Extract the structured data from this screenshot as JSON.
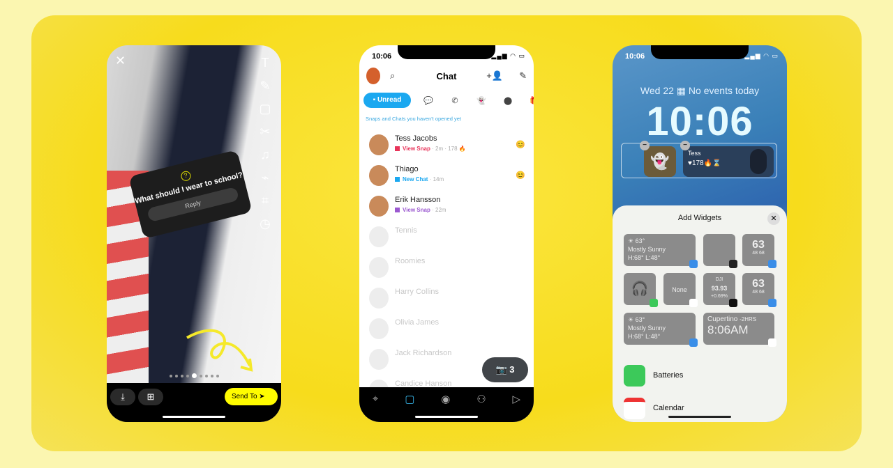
{
  "snap_editor": {
    "close_icon": "x-icon",
    "tools": [
      "text-icon",
      "pencil-icon",
      "sticker-icon",
      "scissors-icon",
      "music-icon",
      "paperclip-icon",
      "crop-icon",
      "timer-icon"
    ],
    "sticker": {
      "question": "What should I wear to school?",
      "reply": "Reply"
    },
    "send_label": "Send To",
    "page_dots": {
      "count": 9,
      "active": 4
    }
  },
  "chat": {
    "time": "10:06",
    "title": "Chat",
    "filters": [
      {
        "label": "Unread",
        "icon": "unread-icon"
      },
      {
        "icon": "chats-icon"
      },
      {
        "icon": "phone-icon"
      },
      {
        "icon": "ghost-icon"
      },
      {
        "icon": "location-icon"
      },
      {
        "icon": "gift-icon"
      }
    ],
    "hint": "Snaps and Chats you haven't opened yet",
    "rows": [
      {
        "name": "Tess Jacobs",
        "status": "View Snap",
        "meta": "· 2m · 178 🔥",
        "color": "#e8345a",
        "emoji": "😊"
      },
      {
        "name": "Thiago",
        "status": "New Chat",
        "meta": "· 14m",
        "color": "#1ba8f0",
        "emoji": "😊"
      },
      {
        "name": "Erik Hansson",
        "status": "View Snap",
        "meta": "· 22m",
        "color": "#9b59d0",
        "emoji": ""
      },
      {
        "name": "Tennis",
        "faded": true
      },
      {
        "name": "Roomies",
        "faded": true
      },
      {
        "name": "Harry Collins",
        "faded": true
      },
      {
        "name": "Olivia James",
        "faded": true
      },
      {
        "name": "Jack Richardson",
        "faded": true
      },
      {
        "name": "Candice Hanson",
        "faded": true
      }
    ],
    "camera_badge_count": "3",
    "nav": [
      "map-icon",
      "chat-icon",
      "camera-icon",
      "friends-icon",
      "stories-icon"
    ],
    "nav_active": 1
  },
  "lockscreen": {
    "time": "10:06",
    "date": "Wed 22",
    "events": "No events today",
    "clock": "10:06",
    "widget_friend": {
      "name": "Tess",
      "stats": "♥178🔥⌛"
    },
    "sheet_title": "Add Widgets",
    "widgets": {
      "weather1": {
        "temp": "☀ 63°",
        "cond": "Mostly Sunny",
        "hl": "H:68° L:48°"
      },
      "gauge": {
        "value": "63",
        "range": "48  68"
      },
      "stocks": {
        "sym": "DJI",
        "value": "93.93",
        "change": "+0.69%"
      },
      "calendar": "None",
      "weather2": {
        "temp": "☀ 63°",
        "cond": "Mostly Sunny",
        "hl": "H:68° L:48°"
      },
      "clock": {
        "city": "Cupertino",
        "offset": "-2HRS",
        "time": "8:06AM"
      }
    },
    "list": [
      {
        "label": "Batteries",
        "color": "#3cc95a"
      },
      {
        "label": "Calendar",
        "color": "#ffffff"
      }
    ]
  }
}
